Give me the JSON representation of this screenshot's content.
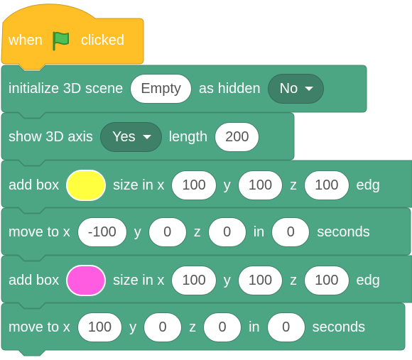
{
  "hat": {
    "when": "when",
    "clicked": "clicked",
    "flag_icon": "green-flag-icon",
    "color": "#ffbf26"
  },
  "blocks_color": "#4da683",
  "init": {
    "label1": "initialize 3D scene",
    "scene": "Empty",
    "label2": "as hidden",
    "hidden": "No"
  },
  "axis": {
    "label1": "show 3D axis",
    "show": "Yes",
    "label2": "length",
    "length": "200"
  },
  "box1": {
    "label1": "add box",
    "color": "#ffff40",
    "label2": "size in x",
    "x": "100",
    "ly": "y",
    "y": "100",
    "lz": "z",
    "z": "100",
    "trail": "edg"
  },
  "move1": {
    "label1": "move to x",
    "x": "-100",
    "ly": "y",
    "y": "0",
    "lz": "z",
    "z": "0",
    "lin": "in",
    "t": "0",
    "lsec": "seconds"
  },
  "box2": {
    "label1": "add box",
    "color": "#ff5ce1",
    "label2": "size in x",
    "x": "100",
    "ly": "y",
    "y": "100",
    "lz": "z",
    "z": "100",
    "trail": "edg"
  },
  "move2": {
    "label1": "move to x",
    "x": "100",
    "ly": "y",
    "y": "0",
    "lz": "z",
    "z": "0",
    "lin": "in",
    "t": "0",
    "lsec": "seconds"
  }
}
